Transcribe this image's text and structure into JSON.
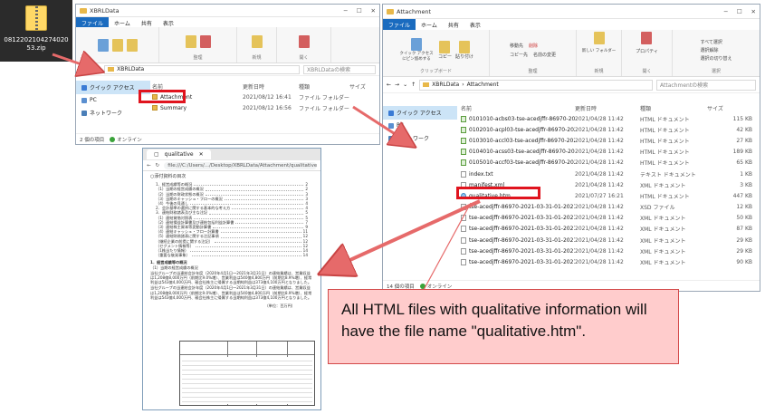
{
  "zip": {
    "filename": "0812202104274020 53.zip"
  },
  "win1": {
    "title": "XBRLData",
    "tabs": [
      "ファイル",
      "ホーム",
      "共有",
      "表示"
    ],
    "ribbon_groups": [
      "整理",
      "新規",
      "開く"
    ],
    "path": "XBRLData",
    "search_placeholder": "XBRLDataの検索",
    "nav": [
      "クイック アクセス",
      "PC",
      "ネットワーク"
    ],
    "columns": [
      "名前",
      "更新日時",
      "種類",
      "サイズ"
    ],
    "rows": [
      {
        "name": "Attachment",
        "date": "2021/08/12 16:41",
        "type": "ファイル フォルダー",
        "size": ""
      },
      {
        "name": "Summary",
        "date": "2021/08/12 16:56",
        "type": "ファイル フォルダー",
        "size": ""
      }
    ],
    "status_items": "2 個の項目",
    "status_online": "オンライン"
  },
  "win2": {
    "title": "Attachment",
    "tabs": [
      "ファイル",
      "ホーム",
      "共有",
      "表示"
    ],
    "ribbon_labels": {
      "pin": "クイック アクセス にピン留めする",
      "copy": "コピー",
      "paste": "貼り付け",
      "move": "移動先",
      "delete": "削除",
      "copyto": "コピー先",
      "rename": "名前の変更",
      "newfolder": "新しい フォルダー",
      "properties": "プロパティ",
      "selectall": "すべて選択",
      "selectnone": "選択解除",
      "invert": "選択の切り替え"
    },
    "ribbon_groups": [
      "クリップボード",
      "整理",
      "新規",
      "開く",
      "選択"
    ],
    "path": [
      "XBRLData",
      "Attachment"
    ],
    "search_placeholder": "Attachmentの検索",
    "nav": [
      "クイック アクセス",
      "PC",
      "ネットワーク"
    ],
    "columns": [
      "名前",
      "更新日時",
      "種類",
      "サイズ"
    ],
    "rows": [
      {
        "name": "0101010-acbs03-tse-acedjffr-86970-2021-...",
        "date": "2021/04/28 11:42",
        "type": "HTML ドキュメント",
        "size": "115 KB",
        "icon": "html"
      },
      {
        "name": "0102010-acpl03-tse-acedjffr-86970-2021-...",
        "date": "2021/04/28 11:42",
        "type": "HTML ドキュメント",
        "size": "42 KB",
        "icon": "html"
      },
      {
        "name": "0103010-accl03-tse-acedjffr-86970-2021-...",
        "date": "2021/04/28 11:42",
        "type": "HTML ドキュメント",
        "size": "27 KB",
        "icon": "html"
      },
      {
        "name": "0104010-acss03-tse-acedjffr-86970-2021-...",
        "date": "2021/04/28 11:42",
        "type": "HTML ドキュメント",
        "size": "189 KB",
        "icon": "html"
      },
      {
        "name": "0105010-accf03-tse-acedjffr-86970-2021-...",
        "date": "2021/04/28 11:42",
        "type": "HTML ドキュメント",
        "size": "65 KB",
        "icon": "html"
      },
      {
        "name": "index.txt",
        "date": "2021/04/28 11:42",
        "type": "テキスト ドキュメント",
        "size": "1 KB",
        "icon": "txt"
      },
      {
        "name": "manifest.xml",
        "date": "2021/04/28 11:42",
        "type": "XML ドキュメント",
        "size": "3 KB",
        "icon": "txt"
      },
      {
        "name": "qualitative.htm",
        "date": "2021/07/27 16:21",
        "type": "HTML ドキュメント",
        "size": "447 KB",
        "icon": "ie"
      },
      {
        "name": "tse-acedjffr-86970-2021-03-31-01-2021-0...",
        "date": "2021/04/28 11:42",
        "type": "XSD ファイル",
        "size": "12 KB",
        "icon": "xsd"
      },
      {
        "name": "tse-acedjffr-86970-2021-03-31-01-2021-0...",
        "date": "2021/04/28 11:42",
        "type": "XML ドキュメント",
        "size": "50 KB",
        "icon": "txt"
      },
      {
        "name": "tse-acedjffr-86970-2021-03-31-01-2021-0...",
        "date": "2021/04/28 11:42",
        "type": "XML ドキュメント",
        "size": "87 KB",
        "icon": "txt"
      },
      {
        "name": "tse-acedjffr-86970-2021-03-31-01-2021-0...",
        "date": "2021/04/28 11:42",
        "type": "XML ドキュメント",
        "size": "29 KB",
        "icon": "txt"
      },
      {
        "name": "tse-acedjffr-86970-2021-03-31-01-2021-0...",
        "date": "2021/04/28 11:42",
        "type": "XML ドキュメント",
        "size": "29 KB",
        "icon": "txt"
      },
      {
        "name": "tse-acedjffr-86970-2021-03-31-01-2021-0...",
        "date": "2021/04/28 11:42",
        "type": "XML ドキュメント",
        "size": "90 KB",
        "icon": "txt"
      }
    ],
    "status_items": "14 個の項目",
    "status_online": "オンライン"
  },
  "browser": {
    "tab_title": "qualitative",
    "url": "file:///C:/Users/.../Desktop/XBRLData/Attachment/qualitative.htm",
    "heading": "○添付資料の目次",
    "toc": [
      {
        "t": "1．経営成績等の概況",
        "p": "2"
      },
      {
        "t": "（1）当期の経営成績の概況",
        "p": "2"
      },
      {
        "t": "（2）当期の財政状態の概況",
        "p": "3"
      },
      {
        "t": "（3）当期のキャッシュ・フローの概況",
        "p": "3"
      },
      {
        "t": "（4）今後の見通し",
        "p": "4"
      },
      {
        "t": "2．会計基準の選択に関する基本的な考え方",
        "p": "4"
      },
      {
        "t": "3．連結財務諸表及び主な注記",
        "p": "5"
      },
      {
        "t": "（1）連結貸借対照表",
        "p": "5"
      },
      {
        "t": "（2）連結損益計算書及び連結包括利益計算書",
        "p": "7"
      },
      {
        "t": "（3）連結株主資本等変動計算書",
        "p": "9"
      },
      {
        "t": "（4）連結キャッシュ・フロー計算書",
        "p": "11"
      },
      {
        "t": "（5）連結財務諸表に関する注記事項",
        "p": "12"
      },
      {
        "t": "（継続企業の前提に関する注記）",
        "p": "12"
      },
      {
        "t": "（セグメント情報等）",
        "p": "12"
      },
      {
        "t": "（1株当たり情報）",
        "p": "14"
      },
      {
        "t": "（重要な後発事象）",
        "p": "14"
      }
    ],
    "section_title": "1．経営成績等の概況",
    "sub_title": "（1）当期の経営成績の概況",
    "para": "当社グループの当連結会計年度（2020年4月1日～2021年3月31日）の連結業績は、営業収益は1,208億8,000万円（前期比9.0%増）、営業利益は540億4,800万円（前期比8.9%増）、経常利益は543億4,000万円、親会社株主に帰属する当期純利益は373億4,100万円となりました。",
    "table_title": "（単位：百万円）"
  },
  "callout": {
    "text": "All HTML files with qualitative information will have the file name \"qualitative.htm\"."
  },
  "colors": {
    "highlight": "#e0141e",
    "callout_bg": "#ffcccc",
    "arrow": "#e66a6a"
  }
}
